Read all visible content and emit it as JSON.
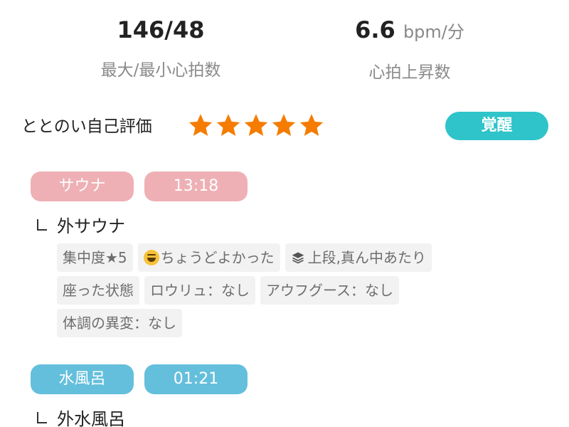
{
  "stats": [
    {
      "value": "146/48",
      "unit": "",
      "label": "最大/最小心拍数"
    },
    {
      "value": "6.6",
      "unit": "bpm/分",
      "label": "心拍上昇数"
    }
  ],
  "rating": {
    "label": "ととのい自己評価",
    "stars": 5,
    "badge": "覚醒",
    "star_color": "#f57c00",
    "badge_color": "#2ec4c9"
  },
  "sections": [
    {
      "name": "サウナ",
      "time": "13:18",
      "color": "#eeb0b5",
      "subtitle": "外サウナ",
      "tags": [
        [
          "集中度★5",
          "ちょうどよかった",
          "上段,真ん中あたり"
        ],
        [
          "座った状態",
          "ロウリュ：なし",
          "アウフグース：なし"
        ],
        [
          "体調の異変：なし"
        ]
      ],
      "icons": {
        "tag_1_2": "grinning-emoji-icon",
        "tag_1_3": "layers-icon"
      }
    },
    {
      "name": "水風呂",
      "time": "01:21",
      "color": "#64bfdc",
      "subtitle": "外水風呂"
    }
  ]
}
